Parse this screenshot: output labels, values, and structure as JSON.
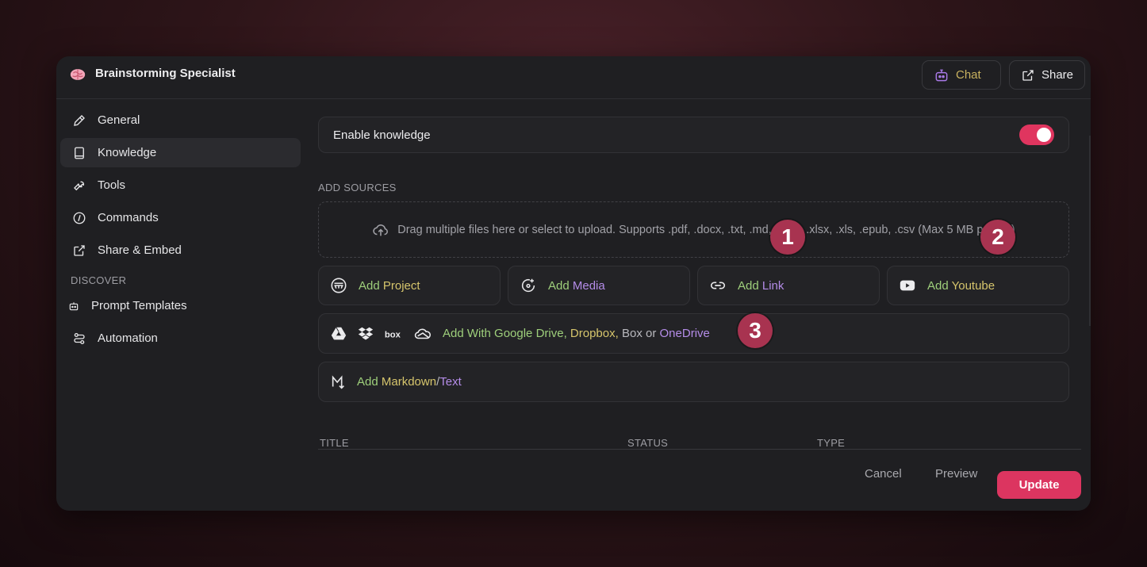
{
  "app": {
    "title": "Brainstorming Specialist",
    "logo_icon": "brain-icon"
  },
  "header": {
    "chat_label": "Chat",
    "share_label": "Share"
  },
  "sidebar": {
    "items": [
      {
        "label": "General",
        "icon": "pencil-icon"
      },
      {
        "label": "Knowledge",
        "icon": "book-icon",
        "active": true
      },
      {
        "label": "Tools",
        "icon": "wrench-icon"
      },
      {
        "label": "Commands",
        "icon": "slash-command-icon"
      },
      {
        "label": "Share & Embed",
        "icon": "share-icon"
      }
    ],
    "discover_label": "DISCOVER",
    "discover_items": [
      {
        "label": "Prompt Templates",
        "icon": "robot-icon"
      },
      {
        "label": "Automation",
        "icon": "automation-icon"
      }
    ]
  },
  "knowledge": {
    "enable_label": "Enable knowledge",
    "enabled": true
  },
  "sources": {
    "section_label": "ADD SOURCES",
    "dropzone_text": "Drag multiple files here or select to upload. Supports .pdf, .docx, .txt, .md, .pptx, .xlsx, .xls, .epub, .csv (Max 5 MB per file)",
    "buttons": {
      "project": {
        "add": "Add",
        "name": "Project"
      },
      "media": {
        "add": "Add",
        "name": "Media"
      },
      "link": {
        "add": "Add",
        "name": "Link"
      },
      "youtube": {
        "add": "Add",
        "name": "Youtube"
      }
    },
    "cloud": {
      "prefix": "Add With",
      "google": "Google Drive,",
      "dropbox": "Dropbox,",
      "box": "Box",
      "or": "or",
      "onedrive": "OneDrive"
    },
    "markdown": {
      "add": "Add",
      "markdown": "Markdown",
      "slash": "/",
      "text": "Text"
    }
  },
  "table": {
    "columns": [
      "TITLE",
      "STATUS",
      "TYPE"
    ]
  },
  "footer": {
    "cancel_label": "Cancel",
    "preview_label": "Preview",
    "update_label": "Update"
  },
  "annotations": [
    "1",
    "2",
    "3"
  ],
  "colors": {
    "accent": "#dc3560",
    "badge": "#a83350",
    "green_text": "#9ecf7b",
    "yellow_text": "#d6c56c",
    "purple_text": "#b48ce8"
  }
}
